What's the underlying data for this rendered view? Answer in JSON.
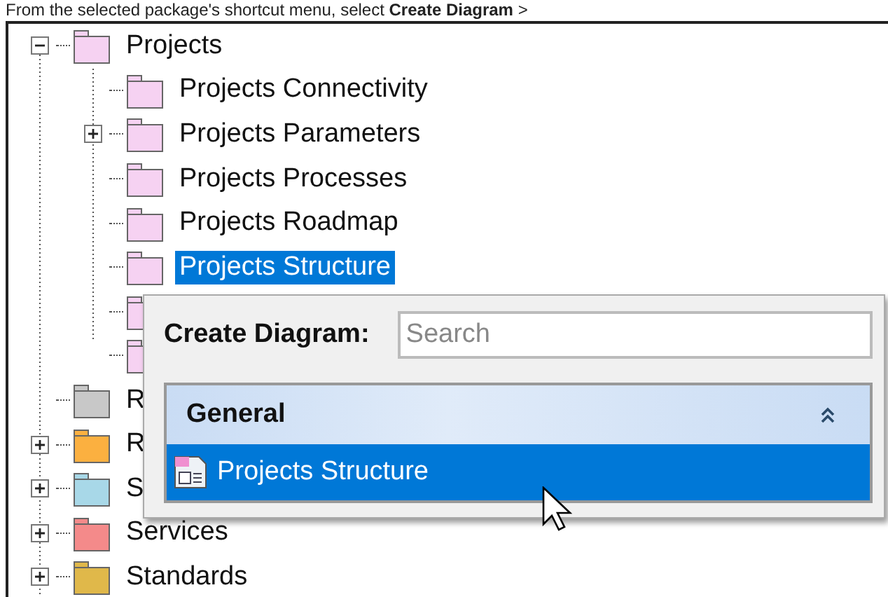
{
  "caption": {
    "text": "From the selected package's shortcut menu, select **Create Diagram** >"
  },
  "tree": [
    {
      "label": "Projects",
      "color": "#f6d2f2",
      "expanded": true,
      "selected": false,
      "children": [
        {
          "label": "Projects Connectivity",
          "color": "#f6d2f2",
          "selected": false
        },
        {
          "label": "Projects Parameters",
          "color": "#f6d2f2",
          "expanded": false,
          "selected": false
        },
        {
          "label": "Projects Processes",
          "color": "#f6d2f2",
          "selected": false
        },
        {
          "label": "Projects Roadmap",
          "color": "#f6d2f2",
          "selected": false
        },
        {
          "label": "Projects Structure",
          "color": "#f6d2f2",
          "selected": true
        },
        {
          "color": "#f6d2f2"
        },
        {
          "color": "#f6d2f2"
        }
      ]
    },
    {
      "label": "R",
      "color": "#c8c8c8",
      "selected": false
    },
    {
      "label": "R",
      "color": "#fbb040",
      "expanded": false,
      "selected": false
    },
    {
      "label": "S",
      "color": "#a8d8e8",
      "expanded": false,
      "selected": false
    },
    {
      "label": "Services",
      "color": "#f48a8a",
      "expanded": false,
      "selected": false
    },
    {
      "label": "Standards",
      "color": "#e0b84a",
      "expanded": false,
      "selected": false
    }
  ],
  "popup": {
    "title": "Create Diagram:",
    "search": {
      "placeholder": "Search"
    },
    "groups": [
      {
        "name": "General",
        "expanded": true,
        "items": [
          {
            "label": "Projects Structure",
            "selected": true
          }
        ]
      }
    ]
  }
}
